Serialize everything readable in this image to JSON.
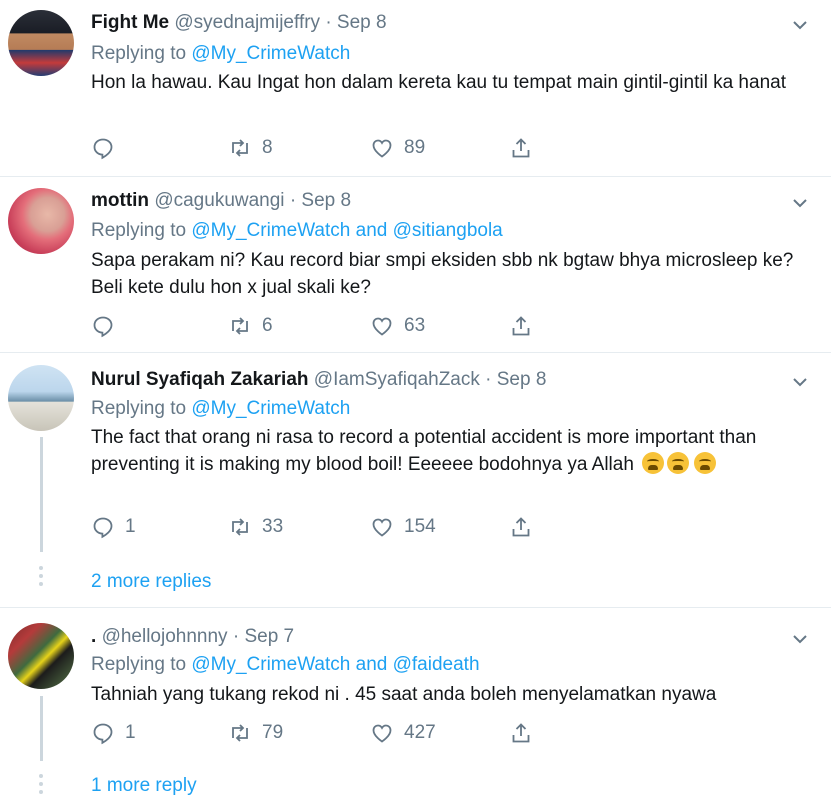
{
  "tweets": [
    {
      "name": "Fight Me",
      "handle": "@syednajmijeffry",
      "date": "· Sep 8",
      "replying_prefix": "Replying to",
      "replying_to": "@My_CrimeWatch",
      "replying_joiner": "",
      "replying_to_2": "",
      "text": "Hon la hawau. Kau Ingat hon dalam kereta kau tu tempat main gintil-gintil ka hanat",
      "replies": "",
      "retweets": "8",
      "likes": "89"
    },
    {
      "name": "mottin",
      "handle": "@cagukuwangi",
      "date": "· Sep 8",
      "replying_prefix": "Replying to",
      "replying_to": "@My_CrimeWatch",
      "replying_joiner": "and",
      "replying_to_2": "@sitiangbola",
      "text": "Sapa perakam ni? Kau record biar smpi eksiden sbb nk bgtaw bhya microsleep ke? Beli kete dulu hon x jual skali ke?",
      "replies": "",
      "retweets": "6",
      "likes": "63"
    },
    {
      "name": "Nurul Syafiqah Zakariah",
      "handle": "@IamSyafiqahZack",
      "date": "· Sep 8",
      "replying_prefix": "Replying to",
      "replying_to": "@My_CrimeWatch",
      "replying_joiner": "",
      "replying_to_2": "",
      "text": "The fact that orang ni rasa to record a potential accident is more important than preventing it is making my blood boil! Eeeeee bodohnya ya Allah",
      "replies": "1",
      "retweets": "33",
      "likes": "154",
      "more_replies": "2 more replies"
    },
    {
      "name": ".",
      "handle": "@hellojohnnny",
      "date": "· Sep 7",
      "replying_prefix": "Replying to",
      "replying_to": "@My_CrimeWatch",
      "replying_joiner": "and",
      "replying_to_2": "@faideath",
      "text": "Tahniah yang tukang rekod ni . 45 saat anda boleh menyelamatkan nyawa",
      "replies": "1",
      "retweets": "79",
      "likes": "427",
      "more_replies": "1 more reply"
    }
  ],
  "colors": {
    "accent": "#1da1f2",
    "muted": "#657786",
    "divider": "#e6ecf0"
  },
  "icons": [
    "reply-icon",
    "retweet-icon",
    "like-icon",
    "share-icon",
    "chevron-down-icon"
  ]
}
